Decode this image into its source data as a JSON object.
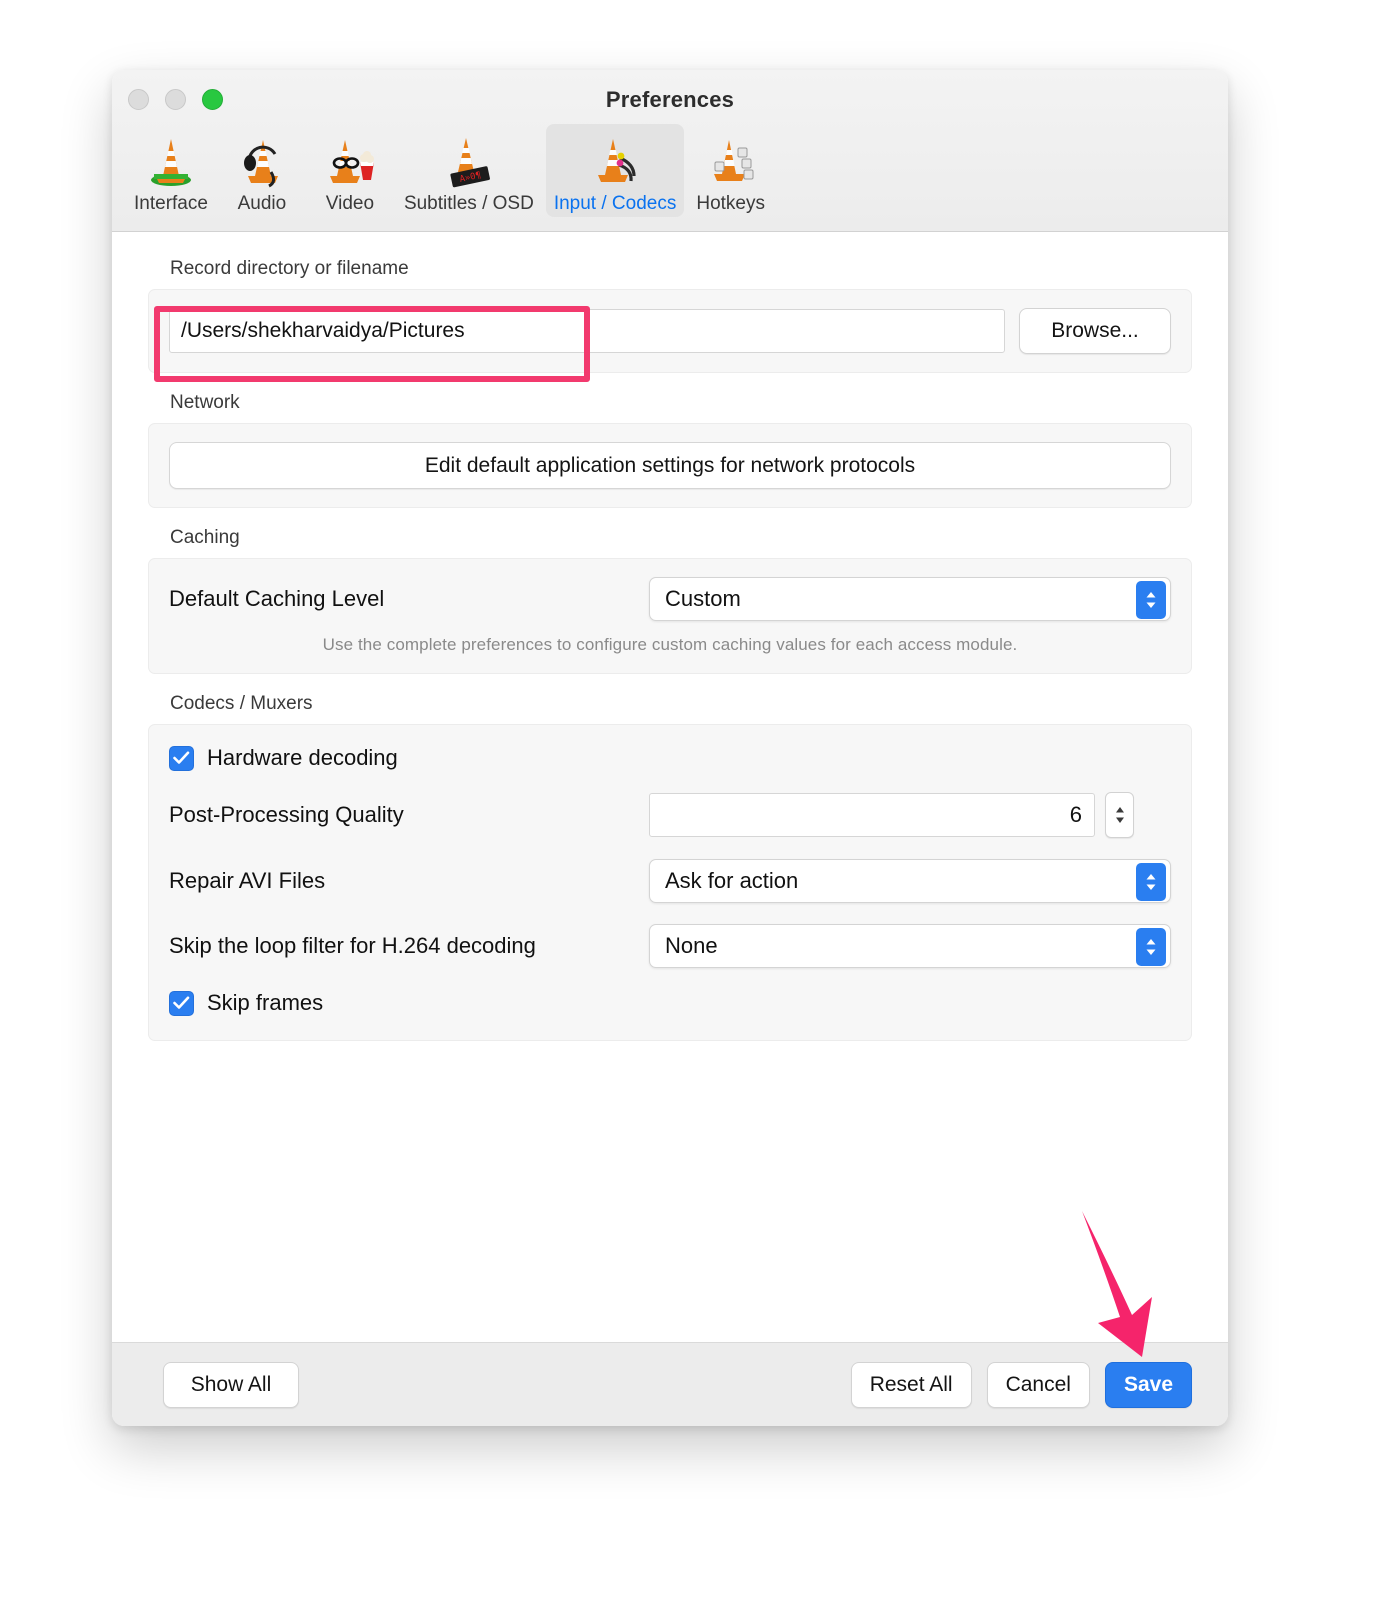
{
  "window": {
    "title": "Preferences",
    "traffic_lights": [
      "close-disabled",
      "minimize-disabled",
      "zoom-green"
    ]
  },
  "toolbar": {
    "tabs": [
      {
        "label": "Interface",
        "icon": "vlc-cone-interface-icon",
        "selected": false
      },
      {
        "label": "Audio",
        "icon": "vlc-cone-headphones-icon",
        "selected": false
      },
      {
        "label": "Video",
        "icon": "vlc-cone-popcorn-icon",
        "selected": false
      },
      {
        "label": "Subtitles / OSD",
        "icon": "vlc-cone-subtitles-icon",
        "selected": false
      },
      {
        "label": "Input / Codecs",
        "icon": "vlc-cone-cables-icon",
        "selected": true
      },
      {
        "label": "Hotkeys",
        "icon": "vlc-cone-keys-icon",
        "selected": false
      }
    ]
  },
  "sections": {
    "record": {
      "label": "Record directory or filename",
      "path_value": "/Users/shekharvaidya/Pictures",
      "path_placeholder": "",
      "browse_label": "Browse..."
    },
    "network": {
      "label": "Network",
      "edit_button_label": "Edit default application settings for network protocols"
    },
    "caching": {
      "label": "Caching",
      "level_label": "Default Caching Level",
      "level_value": "Custom",
      "hint": "Use the complete preferences to configure custom caching values for each access module."
    },
    "codecs": {
      "label": "Codecs / Muxers",
      "hardware_decoding_label": "Hardware decoding",
      "hardware_decoding_checked": true,
      "post_processing_label": "Post-Processing Quality",
      "post_processing_value": "6",
      "repair_avi_label": "Repair AVI Files",
      "repair_avi_value": "Ask for action",
      "skip_loop_label": "Skip the loop filter for H.264 decoding",
      "skip_loop_value": "None",
      "skip_frames_label": "Skip frames",
      "skip_frames_checked": true
    }
  },
  "footer": {
    "show_all_label": "Show All",
    "reset_all_label": "Reset All",
    "cancel_label": "Cancel",
    "save_label": "Save"
  },
  "annotations": {
    "highlight_color": "#f23a6e",
    "arrow_color": "#f5246b",
    "highlight_target": "record-path-input",
    "arrow_target": "save-button"
  },
  "colors": {
    "accent_blue": "#2a7ef0",
    "tab_selected_text": "#0a72ef",
    "window_bg": "#ffffff",
    "toolbar_bg": "#f0f0f0",
    "footer_bg": "#ececec",
    "group_bg": "#f7f7f7"
  }
}
